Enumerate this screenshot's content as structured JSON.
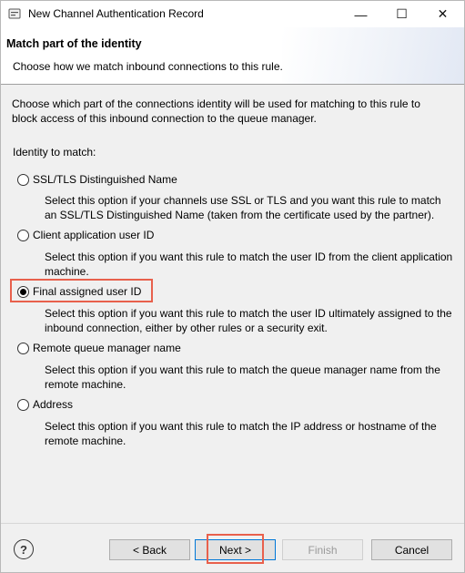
{
  "window": {
    "title": "New Channel Authentication Record",
    "minimize_glyph": "—",
    "maximize_glyph": "☐",
    "close_glyph": "✕"
  },
  "header": {
    "title": "Match part of the identity",
    "description": "Choose how we match inbound connections to this rule."
  },
  "content": {
    "intro": "Choose which part of the connections identity will be used for matching to this rule to block access of this inbound connection to the queue manager.",
    "identity_label": "Identity to match:",
    "options": [
      {
        "label": "SSL/TLS Distinguished Name",
        "description": "Select this option if your channels use SSL or TLS and you want this rule to match an SSL/TLS Distinguished Name (taken from the certificate used by the partner).",
        "selected": false
      },
      {
        "label": "Client application user ID",
        "description": "Select this option if you want this rule to match the user ID from the client application machine.",
        "selected": false
      },
      {
        "label": "Final assigned user ID",
        "description": "Select this option if you want this rule to match the user ID ultimately assigned to the inbound connection, either by other rules or a security exit.",
        "selected": true
      },
      {
        "label": "Remote queue manager name",
        "description": "Select this option if you want this rule to match the queue manager name from the remote machine.",
        "selected": false
      },
      {
        "label": "Address",
        "description": "Select this option if you want this rule to match the IP address or hostname of the remote machine.",
        "selected": false
      }
    ]
  },
  "footer": {
    "help_glyph": "?",
    "back_label": "< Back",
    "next_label": "Next >",
    "finish_label": "Finish",
    "cancel_label": "Cancel"
  },
  "colors": {
    "highlight": "#e8604c",
    "focus_border": "#0078d7"
  }
}
